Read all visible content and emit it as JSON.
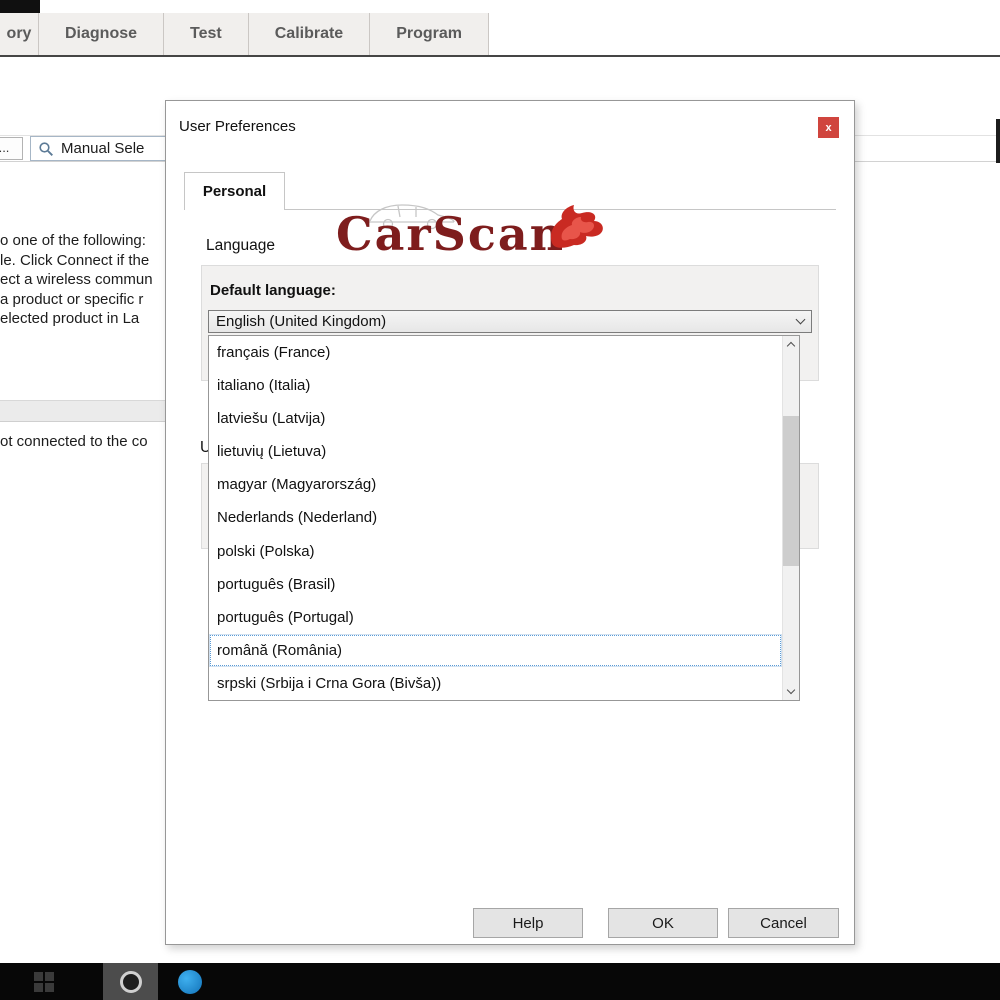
{
  "toolbar": {
    "tabs": [
      "ory",
      "Diagnose",
      "Test",
      "Calibrate",
      "Program"
    ]
  },
  "secondary_toolbar": {
    "ellipsis_button": "...",
    "manual_select_button": "Manual Sele"
  },
  "background_page": {
    "text_lines": [
      "o one of the following:",
      "le. Click Connect if the",
      "ect a wireless commun",
      "a product or specific r",
      "elected product in La"
    ],
    "status_text": "ot connected to the co"
  },
  "dialog": {
    "title": "User Preferences",
    "close_button": "x",
    "tab_label": "Personal",
    "logo_text": "CarScan",
    "language_section_label": "Language",
    "default_language_label": "Default language:",
    "selected_language": "English (United Kingdom)",
    "partial_group_label": "U",
    "language_options": [
      "français (France)",
      "italiano (Italia)",
      "latviešu (Latvija)",
      "lietuvių (Lietuva)",
      "magyar (Magyarország)",
      "Nederlands (Nederland)",
      "polski (Polska)",
      "português (Brasil)",
      "português (Portugal)",
      "română (România)",
      "srpski (Srbija i Crna Gora (Bivša))"
    ],
    "focused_option": "română (România)",
    "focused_option_index": 9,
    "buttons": [
      "Help",
      "OK",
      "Cancel"
    ]
  },
  "colors": {
    "close_button_red": "#d0453e",
    "logo_maroon": "#7e1d1d",
    "flame_red": "#c92a22",
    "tab_gray": "#5b5b5b",
    "browser_icon_blue": "#1272b8"
  }
}
